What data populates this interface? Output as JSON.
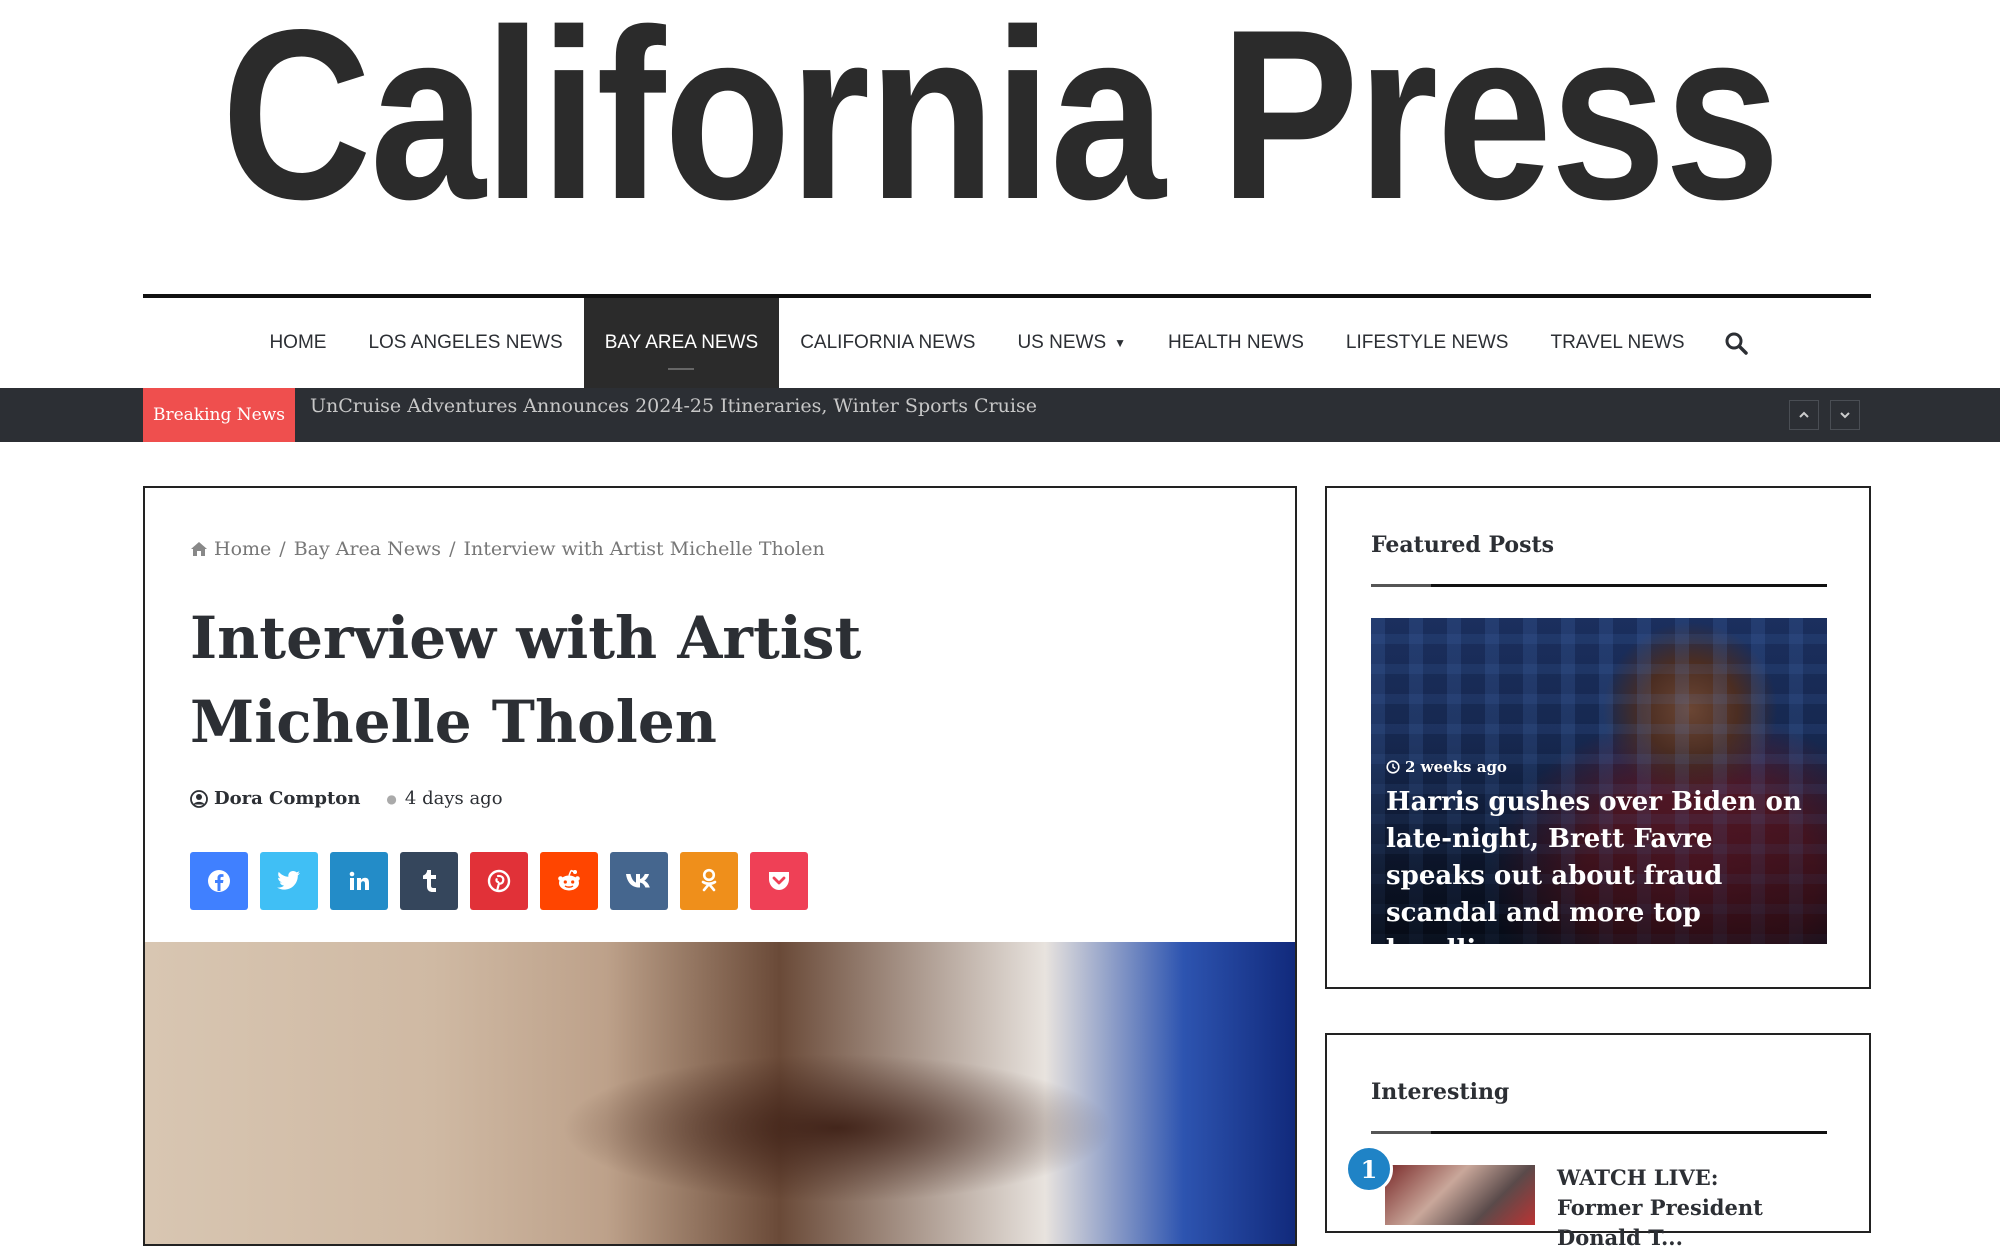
{
  "site": {
    "logo_text": "California Press"
  },
  "nav": {
    "items": [
      {
        "label": "HOME"
      },
      {
        "label": "LOS ANGELES NEWS"
      },
      {
        "label": "BAY AREA NEWS"
      },
      {
        "label": "CALIFORNIA NEWS"
      },
      {
        "label": "US NEWS"
      },
      {
        "label": "HEALTH NEWS"
      },
      {
        "label": "LIFESTYLE NEWS"
      },
      {
        "label": "TRAVEL NEWS"
      }
    ],
    "active": "BAY AREA NEWS"
  },
  "breaking": {
    "label": "Breaking News",
    "headline": "UnCruise Adventures Announces 2024-25 Itineraries, Winter Sports Cruise"
  },
  "breadcrumb": {
    "home": "Home",
    "separator": "/",
    "category": "Bay Area News",
    "current": "Interview with Artist Michelle Tholen"
  },
  "article": {
    "title": "Interview with Artist Michelle Tholen",
    "author": "Dora Compton",
    "date": "4 days ago"
  },
  "share": [
    {
      "name": "facebook",
      "color": "#4080ff"
    },
    {
      "name": "twitter",
      "color": "#40bff5"
    },
    {
      "name": "linkedin",
      "color": "#238cc8"
    },
    {
      "name": "tumblr",
      "color": "#35465c"
    },
    {
      "name": "pinterest",
      "color": "#e13138"
    },
    {
      "name": "reddit",
      "color": "#ff4500"
    },
    {
      "name": "vk",
      "color": "#45668e"
    },
    {
      "name": "odnoklassniki",
      "color": "#ef8f1b"
    },
    {
      "name": "pocket",
      "color": "#ef4056"
    }
  ],
  "featured": {
    "title": "Featured Posts",
    "post": {
      "time": "2 weeks ago",
      "headline": "Harris gushes over Biden on late-night, Brett Favre speaks out about fraud scandal and more top headlines"
    }
  },
  "interesting": {
    "title": "Interesting",
    "items": [
      {
        "rank": "1",
        "headline": "WATCH LIVE: Former President Donald T..."
      }
    ]
  },
  "colors": {
    "accent_red": "#ef4f4e",
    "dark": "#2c2f34",
    "badge_blue": "#1f83c6"
  }
}
